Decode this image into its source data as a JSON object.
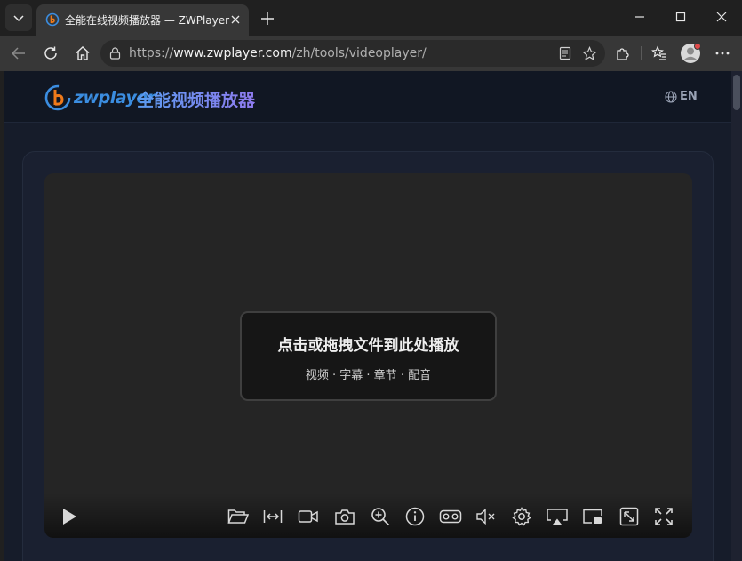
{
  "browser": {
    "tab": {
      "title": "全能在线视频播放器 — ZWPlayer"
    },
    "address": {
      "url_prefix": "https://",
      "url_host": "www.zwplayer.com",
      "url_path": "/zh/tools/videoplayer/"
    }
  },
  "site": {
    "logo_text": "zwplayer",
    "title": "全能视频播放器",
    "lang_label": "EN"
  },
  "player": {
    "dropzone_title": "点击或拖拽文件到此处播放",
    "dropzone_subtitle": "视频 · 字幕 · 章节 · 配音"
  },
  "colors": {
    "accent_blue": "#3b8de0",
    "logo_orange": "#f07a1a",
    "title_gradient_start": "#5b9cf0",
    "title_gradient_end": "#8f7bf0"
  }
}
